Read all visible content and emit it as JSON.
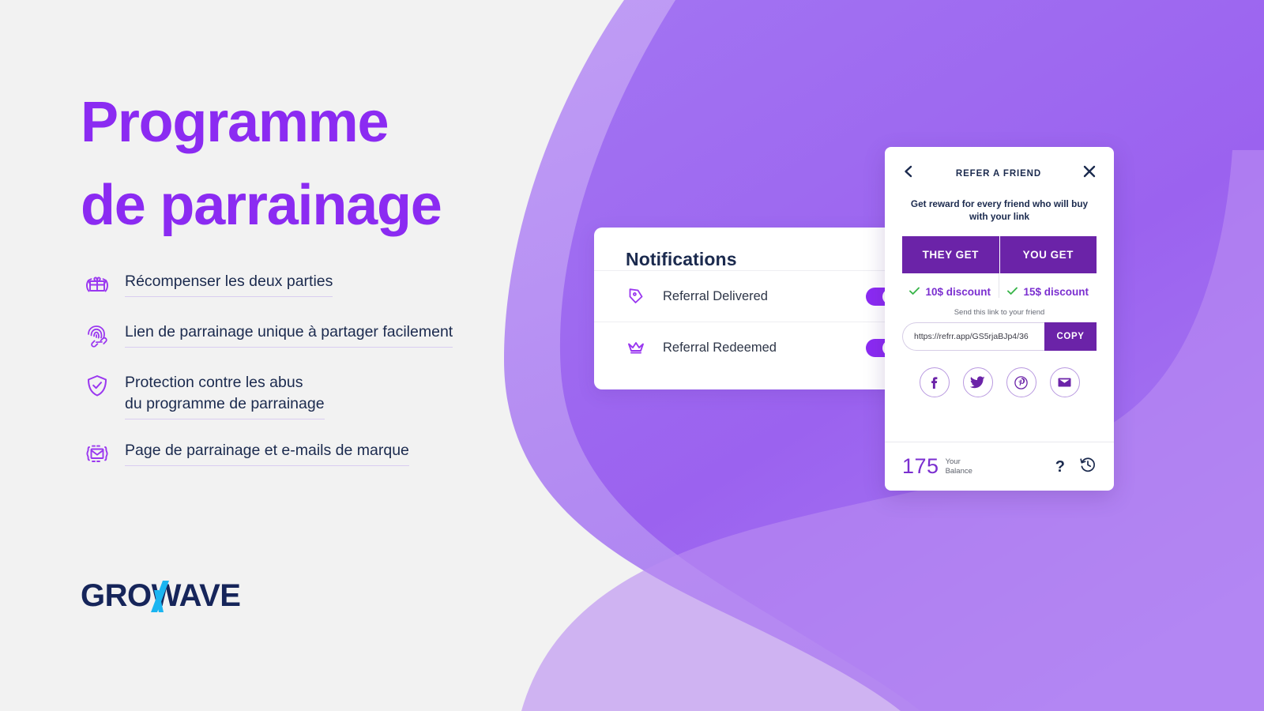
{
  "colors": {
    "background": "#f2f2f2",
    "blob_light": "#b388f0",
    "blob_dark": "#9b62ef",
    "title_purple": "#8b2bf2",
    "accent_purple": "#7b2fd0",
    "deep_purple": "#6b23a8",
    "toggle_on": "#8b2bf2",
    "navy": "#1b2a4e",
    "check_green": "#39b54a",
    "logo_navy": "#16255a",
    "logo_cyan": "#1ab5f1"
  },
  "hero": {
    "title": "Programme\nde parrainage"
  },
  "features": [
    {
      "icon": "gift-reward-icon",
      "text": "Récompenser les deux parties"
    },
    {
      "icon": "fingerprint-link-icon",
      "text": "Lien de parrainage unique à partager facilement"
    },
    {
      "icon": "shield-check-icon",
      "text": "Protection contre les abus\ndu programme de parrainage"
    },
    {
      "icon": "branded-email-icon",
      "text": "Page de parrainage et e-mails de marque"
    }
  ],
  "logo": {
    "text_left": "GRO",
    "text_accent": "W",
    "text_right": "AVE",
    "full": "GROWAVE"
  },
  "notifications": {
    "title": "Notifications",
    "rows": [
      {
        "icon": "tag-icon",
        "label": "Referral Delivered",
        "toggle_on": true
      },
      {
        "icon": "crown-icon",
        "label": "Referral Redeemed",
        "toggle_on": true
      }
    ]
  },
  "widget": {
    "back_icon": "chevron-left-icon",
    "close_icon": "close-icon",
    "header_title": "REFER A FRIEND",
    "subtitle": "Get reward for every friend who will buy\nwith your link",
    "rewards": [
      {
        "heading": "THEY GET",
        "value": "10$ discount",
        "check": "check-icon"
      },
      {
        "heading": "YOU GET",
        "value": "15$ discount",
        "check": "check-icon"
      }
    ],
    "send_link_label": "Send this link to your friend",
    "link_value": "https://refrr.app/GS5rjaBJp4/36",
    "link_placeholder": "https://refrr.app/GS5rjaBJp4/36",
    "copy_label": "COPY",
    "social": [
      {
        "icon": "facebook-icon",
        "name": "Facebook"
      },
      {
        "icon": "twitter-icon",
        "name": "Twitter"
      },
      {
        "icon": "pinterest-icon",
        "name": "Pinterest"
      },
      {
        "icon": "email-icon",
        "name": "Email"
      }
    ],
    "footer": {
      "balance_value": "175",
      "balance_label": "Your\nBalance",
      "help_icon": "?",
      "history_icon": "history-icon"
    }
  }
}
